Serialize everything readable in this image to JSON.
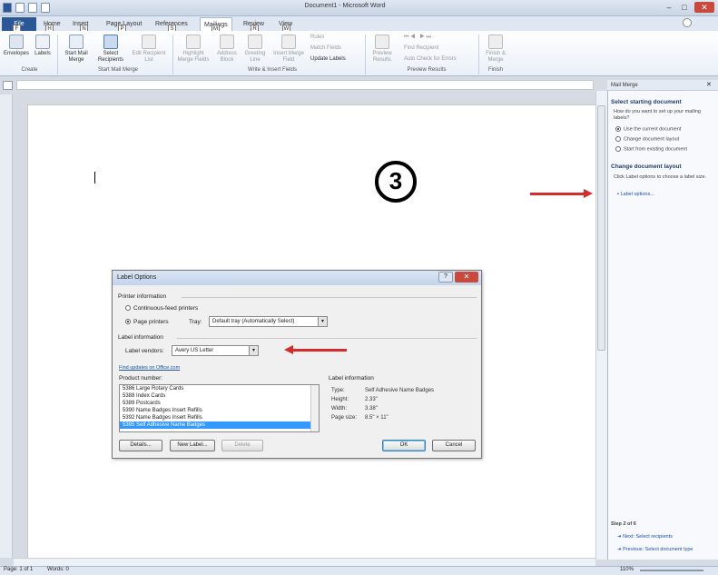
{
  "window": {
    "title": "Document1 - Microsoft Word"
  },
  "tabs": [
    {
      "label": "File",
      "key": "F"
    },
    {
      "label": "Home",
      "key": "H"
    },
    {
      "label": "Insert",
      "key": "N"
    },
    {
      "label": "Page Layout",
      "key": "P"
    },
    {
      "label": "References",
      "key": "S"
    },
    {
      "label": "Mailings",
      "key": "M"
    },
    {
      "label": "Review",
      "key": "R"
    },
    {
      "label": "View",
      "key": "W"
    }
  ],
  "ribbon": {
    "create": {
      "label": "Create",
      "envelopes": "Envelopes",
      "labels": "Labels"
    },
    "start": {
      "label": "Start Mail Merge",
      "start_merge": "Start Mail Merge",
      "select_recipients": "Select Recipients",
      "edit_list": "Edit Recipient List"
    },
    "write": {
      "label": "Write & Insert Fields",
      "highlight": "Highlight Merge Fields",
      "address_block": "Address Block",
      "greeting_line": "Greeting Line",
      "insert_field": "Insert Merge Field",
      "rules": "Rules",
      "match_fields": "Match Fields",
      "update_labels": "Update Labels"
    },
    "preview": {
      "label": "Preview Results",
      "preview": "Preview Results",
      "find_recipient": "Find Recipient",
      "auto_check": "Auto Check for Errors"
    },
    "finish": {
      "label": "Finish",
      "finish_merge": "Finish & Merge"
    }
  },
  "step_number": "3",
  "task_pane": {
    "title": "Mail Merge",
    "section1_title": "Select starting document",
    "section1_text": "How do you want to set up your mailing labels?",
    "options": [
      "Use the current document",
      "Change document layout",
      "Start from existing document"
    ],
    "selected_option": 0,
    "section2_title": "Change document layout",
    "section2_text": "Click Label options to choose a label size.",
    "label_options_link": "Label options...",
    "step": "Step 2 of 6",
    "next": "Next: Select recipients",
    "previous": "Previous: Select document type"
  },
  "dialog": {
    "title": "Label Options",
    "help": "?",
    "close": "✕",
    "printer_info_label": "Printer information",
    "continuous": "Continuous-feed printers",
    "page_printers": "Page printers",
    "tray_label": "Tray:",
    "tray_value": "Default tray (Automatically Select)",
    "label_info_label": "Label information",
    "vendor_label": "Label vendors:",
    "vendor_value": "Avery US Letter",
    "find_updates": "Find updates on Office.com",
    "product_number_label": "Product number:",
    "products": [
      "5386 Large Rotary Cards",
      "5388 Index Cards",
      "5389 Postcards",
      "5390 Name Badges Insert Refills",
      "5392 Name Badges Insert Refills",
      "5395 Self Adhesive Name Badges"
    ],
    "selected_product": 5,
    "info_heading": "Label information",
    "info": [
      {
        "k": "Type:",
        "v": "Self Adhesive Name Badges"
      },
      {
        "k": "Height:",
        "v": "2.33\""
      },
      {
        "k": "Width:",
        "v": "3.38\""
      },
      {
        "k": "Page size:",
        "v": "8.5\" × 11\""
      }
    ],
    "details_btn": "Details...",
    "new_label_btn": "New Label...",
    "delete_btn": "Delete",
    "ok_btn": "OK",
    "cancel_btn": "Cancel"
  },
  "status": {
    "page": "Page: 1 of 1",
    "words": "Words: 0",
    "zoom": "110%"
  },
  "colors": {
    "accent": "#2b5797",
    "arrow": "#d42b2b",
    "selection": "#3399ff"
  }
}
